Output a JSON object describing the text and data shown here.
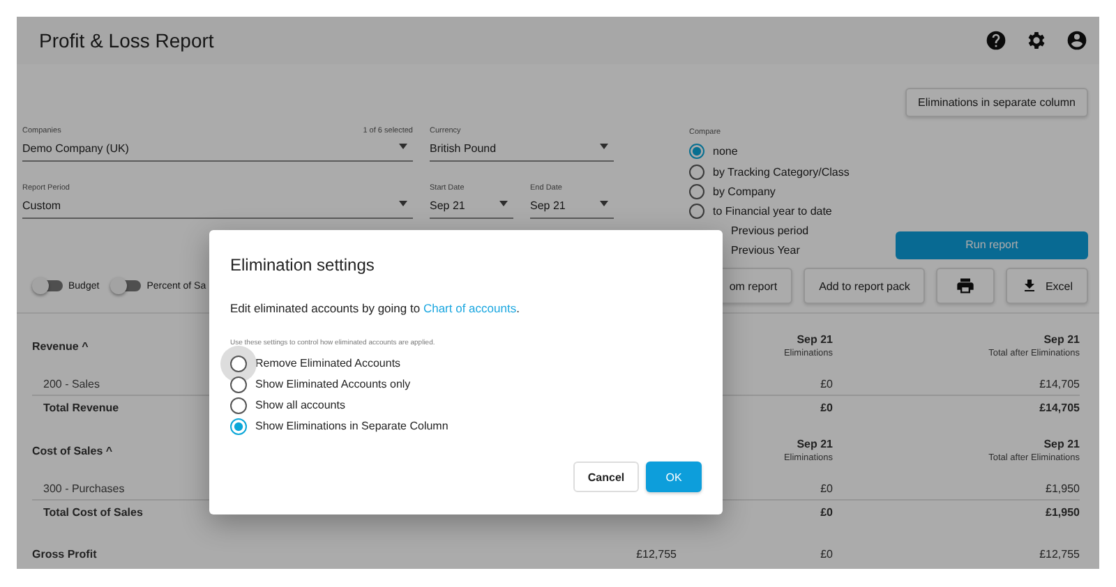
{
  "header": {
    "title": "Profit & Loss Report"
  },
  "eliminations_button": "Eliminations in separate column",
  "filters": {
    "companies": {
      "label": "Companies",
      "value": "Demo Company (UK)",
      "note": "1 of 6 selected"
    },
    "currency": {
      "label": "Currency",
      "value": "British Pound"
    },
    "report_period": {
      "label": "Report Period",
      "value": "Custom"
    },
    "start_date": {
      "label": "Start Date",
      "value": "Sep 21"
    },
    "end_date": {
      "label": "End Date",
      "value": "Sep 21"
    }
  },
  "compare": {
    "label": "Compare",
    "options": [
      {
        "label": "none",
        "selected": true
      },
      {
        "label": "by Tracking Category/Class",
        "selected": false
      },
      {
        "label": "by Company",
        "selected": false
      },
      {
        "label": "to Financial year to date",
        "selected": false
      },
      {
        "kind": "partial",
        "label": "Previous period"
      },
      {
        "kind": "partial",
        "label": "Previous Year"
      }
    ]
  },
  "run_button": "Run report",
  "toggles": [
    {
      "label": "Budget",
      "on": false
    },
    {
      "label": "Percent of Sa",
      "on": false
    }
  ],
  "actions": [
    {
      "kind": "text",
      "label": "om report"
    },
    {
      "kind": "text",
      "label": "Add to report pack"
    },
    {
      "kind": "print"
    },
    {
      "kind": "download",
      "label": "Excel"
    }
  ],
  "sections": [
    {
      "title": "Revenue ^",
      "headers": [
        {
          "period": "Sep 21",
          "name": "Eliminations"
        },
        {
          "period": "Sep 21",
          "name": "Total after Eliminations"
        }
      ],
      "rows": [
        {
          "kind": "line",
          "label": "200 - Sales",
          "eliminations": "£0",
          "total_after": "£14,705"
        },
        {
          "kind": "total",
          "label": "Total Revenue",
          "eliminations": "£0",
          "total_after": "£14,705"
        }
      ]
    },
    {
      "title": "Cost of Sales ^",
      "headers": [
        {
          "period": "Sep 21",
          "name": "Eliminations"
        },
        {
          "period": "Sep 21",
          "name": "Total after Eliminations"
        }
      ],
      "rows": [
        {
          "kind": "line",
          "label": "300 - Purchases",
          "eliminations": "£0",
          "total_after": "£1,950"
        },
        {
          "kind": "total",
          "label": "Total Cost of Sales",
          "eliminations": "£0",
          "total_after": "£1,950"
        }
      ]
    },
    {
      "title": "Gross Profit",
      "values": [
        "£12,755",
        "£0",
        "£12,755"
      ]
    }
  ],
  "dialog": {
    "title": "Elimination settings",
    "text": "Edit eliminated accounts by going to",
    "link": "Chart of accounts",
    "link_after": ".",
    "hint": "Use these settings to control how eliminated accounts are applied.",
    "options": [
      {
        "label": "Remove Eliminated Accounts",
        "selected": false,
        "focused": true
      },
      {
        "label": "Show Eliminated Accounts only",
        "selected": false,
        "focused": false
      },
      {
        "label": "Show all accounts",
        "selected": false,
        "focused": false
      },
      {
        "label": "Show Eliminations in Separate Column",
        "selected": true,
        "focused": false
      }
    ],
    "buttons": [
      {
        "kind": "secondary",
        "label": "Cancel"
      },
      {
        "kind": "primary",
        "label": "OK"
      }
    ]
  }
}
